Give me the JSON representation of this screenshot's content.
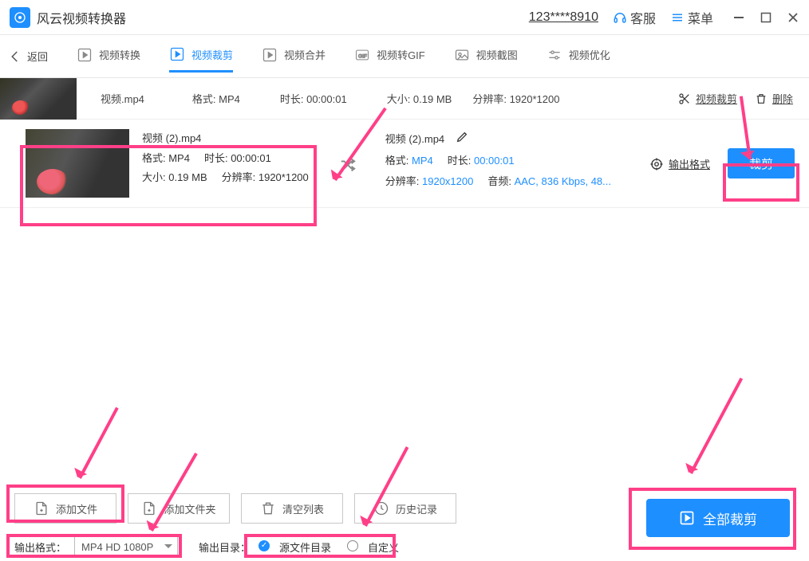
{
  "app": {
    "title": "风云视频转换器"
  },
  "header": {
    "account": "123****8910",
    "support": "客服",
    "menu": "菜单"
  },
  "nav": {
    "back": "返回",
    "tabs": [
      {
        "label": "视频转换"
      },
      {
        "label": "视频裁剪"
      },
      {
        "label": "视频合并"
      },
      {
        "label": "视频转GIF"
      },
      {
        "label": "视频截图"
      },
      {
        "label": "视频优化"
      }
    ]
  },
  "file_row": {
    "name": "视频.mp4",
    "format": "格式: MP4",
    "duration": "时长: 00:00:01",
    "size": "大小: 0.19 MB",
    "resolution": "分辨率: 1920*1200",
    "crop": "视频裁剪",
    "delete": "删除"
  },
  "detail": {
    "left": {
      "name": "视频 (2).mp4",
      "format": "格式: MP4",
      "duration": "时长: 00:00:01",
      "size": "大小: 0.19 MB",
      "resolution": "分辨率: 1920*1200"
    },
    "right": {
      "name": "视频 (2).mp4",
      "format_label": "格式: ",
      "format_val": "MP4",
      "duration_label": "时长: ",
      "duration_val": "00:00:01",
      "resolution_label": "分辨率: ",
      "resolution_val": "1920x1200",
      "audio_label": "音频: ",
      "audio_val": "AAC, 836 Kbps, 48..."
    },
    "output_format": "输出格式",
    "crop_btn": "裁剪"
  },
  "bottom": {
    "add_file": "添加文件",
    "add_folder": "添加文件夹",
    "clear_list": "清空列表",
    "history": "历史记录",
    "output_format_label": "输出格式：",
    "output_format_value": "MP4 HD 1080P",
    "output_dir_label": "输出目录：",
    "radio_source": "源文件目录",
    "radio_custom": "自定义",
    "crop_all": "全部裁剪"
  }
}
